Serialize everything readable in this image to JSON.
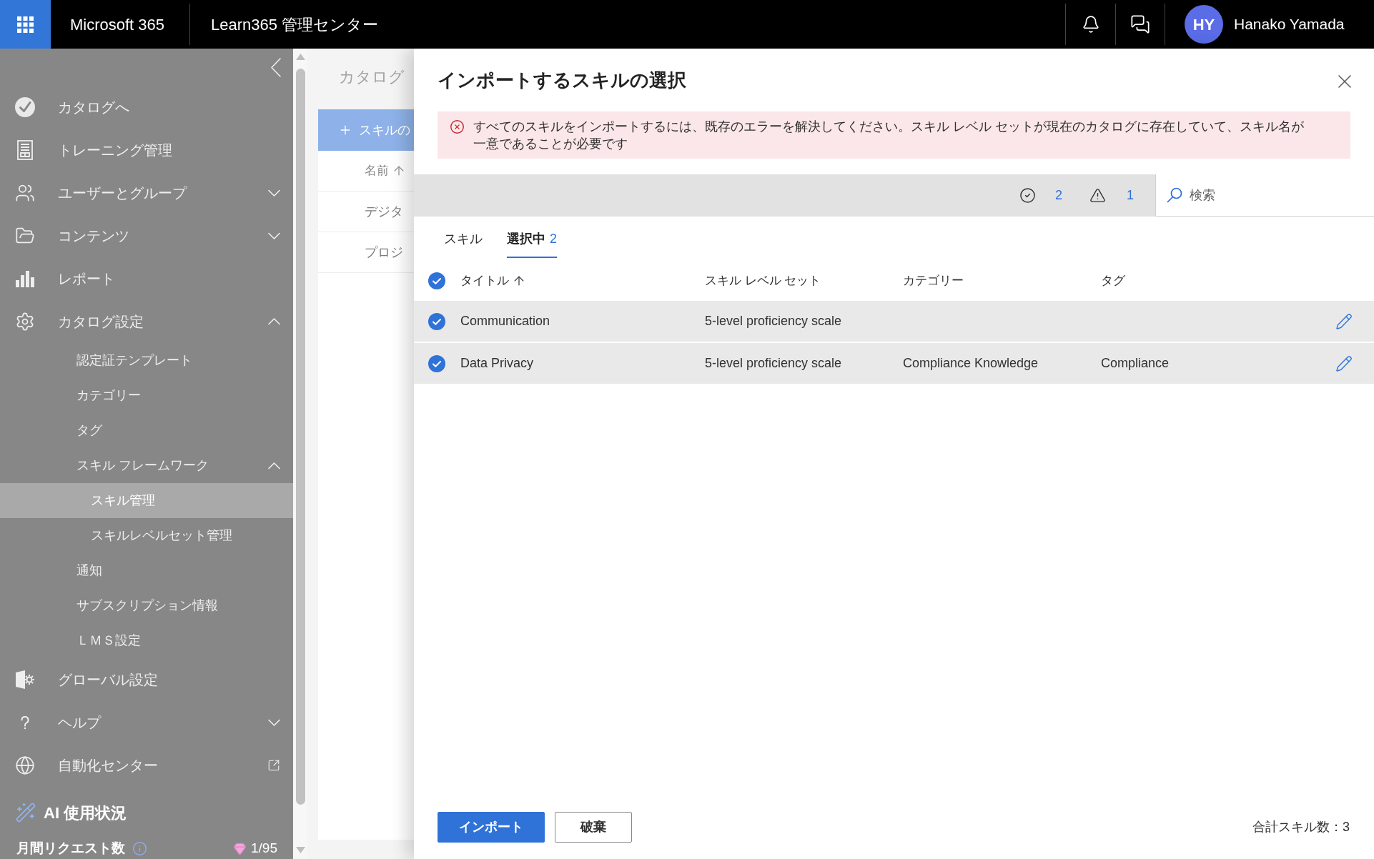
{
  "top_bar": {
    "app_name": "Microsoft 365",
    "title": "Learn365 管理センター",
    "user": {
      "initials": "HY",
      "name": "Hanako Yamada"
    }
  },
  "sidebar": {
    "items": [
      {
        "label": "カタログへ",
        "kind": "link",
        "selected": false
      },
      {
        "label": "トレーニング管理",
        "kind": "link",
        "selected": false
      },
      {
        "label": "ユーザーとグループ",
        "kind": "group",
        "expanded": false,
        "selected": false
      },
      {
        "label": "コンテンツ",
        "kind": "group",
        "expanded": false,
        "selected": false
      },
      {
        "label": "レポート",
        "kind": "link",
        "selected": false
      },
      {
        "label": "カタログ設定",
        "kind": "group",
        "expanded": true,
        "selected": false,
        "children": [
          {
            "label": "認定証テンプレート",
            "kind": "link",
            "selected": false
          },
          {
            "label": "カテゴリー",
            "kind": "link",
            "selected": false
          },
          {
            "label": "タグ",
            "kind": "link",
            "selected": false
          },
          {
            "label": "スキル フレームワーク",
            "kind": "group",
            "expanded": true,
            "selected": false,
            "children": [
              {
                "label": "スキル管理",
                "kind": "link",
                "selected": true
              },
              {
                "label": "スキルレベルセット管理",
                "kind": "link",
                "selected": false
              }
            ]
          },
          {
            "label": "通知",
            "kind": "link",
            "selected": false
          },
          {
            "label": "サブスクリプション情報",
            "kind": "link",
            "selected": false
          },
          {
            "label": "ＬＭＳ設定",
            "kind": "link",
            "selected": false
          }
        ]
      },
      {
        "label": "グローバル設定",
        "kind": "link",
        "selected": false
      },
      {
        "label": "ヘルプ",
        "kind": "group",
        "expanded": false,
        "selected": false
      },
      {
        "label": "自動化センター",
        "kind": "external",
        "selected": false
      }
    ],
    "ai_usage": {
      "title": "AI 使用状況",
      "requests_label": "月間リクエスト数",
      "requests_count": "1/95"
    }
  },
  "catalog_page": {
    "heading": "カタログ",
    "add_button": "スキルの",
    "table": {
      "columns": [
        {
          "label": "名前",
          "sorted": true
        }
      ],
      "rows": [
        "デジタ",
        "プロジ"
      ]
    }
  },
  "import_panel": {
    "title": "インポートするスキルの選択",
    "error": {
      "message": "すべてのスキルをインポートするには、既存のエラーを解決してください。スキル レベル セットが現在のカタログに存在していて、スキル名が一意であることが必要です"
    },
    "toolbar": {
      "valid_count": "2",
      "warning_count": "1",
      "search": {
        "placeholder": "検索"
      }
    },
    "tabs": [
      {
        "label": "スキル",
        "selected": false
      },
      {
        "label": "選択中",
        "count": "2",
        "selected": true
      }
    ],
    "table": {
      "all_selected": true,
      "columns": [
        {
          "label": "タイトル",
          "sorted": true
        },
        {
          "label": "スキル レベル セット",
          "sorted": false
        },
        {
          "label": "カテゴリー",
          "sorted": false
        },
        {
          "label": "タグ",
          "sorted": false
        }
      ],
      "rows": [
        {
          "selected": true,
          "title": "Communication",
          "skill_level_set": "5-level proficiency scale"
        },
        {
          "selected": true,
          "title": "Data Privacy",
          "skill_level_set": "5-level proficiency scale",
          "category": "Compliance Knowledge",
          "tag": "Compliance"
        }
      ]
    },
    "buttons": [
      {
        "label": "インポート",
        "kind": "primary"
      },
      {
        "label": "破棄",
        "kind": "secondary"
      }
    ],
    "total": "合計スキル数：3"
  }
}
